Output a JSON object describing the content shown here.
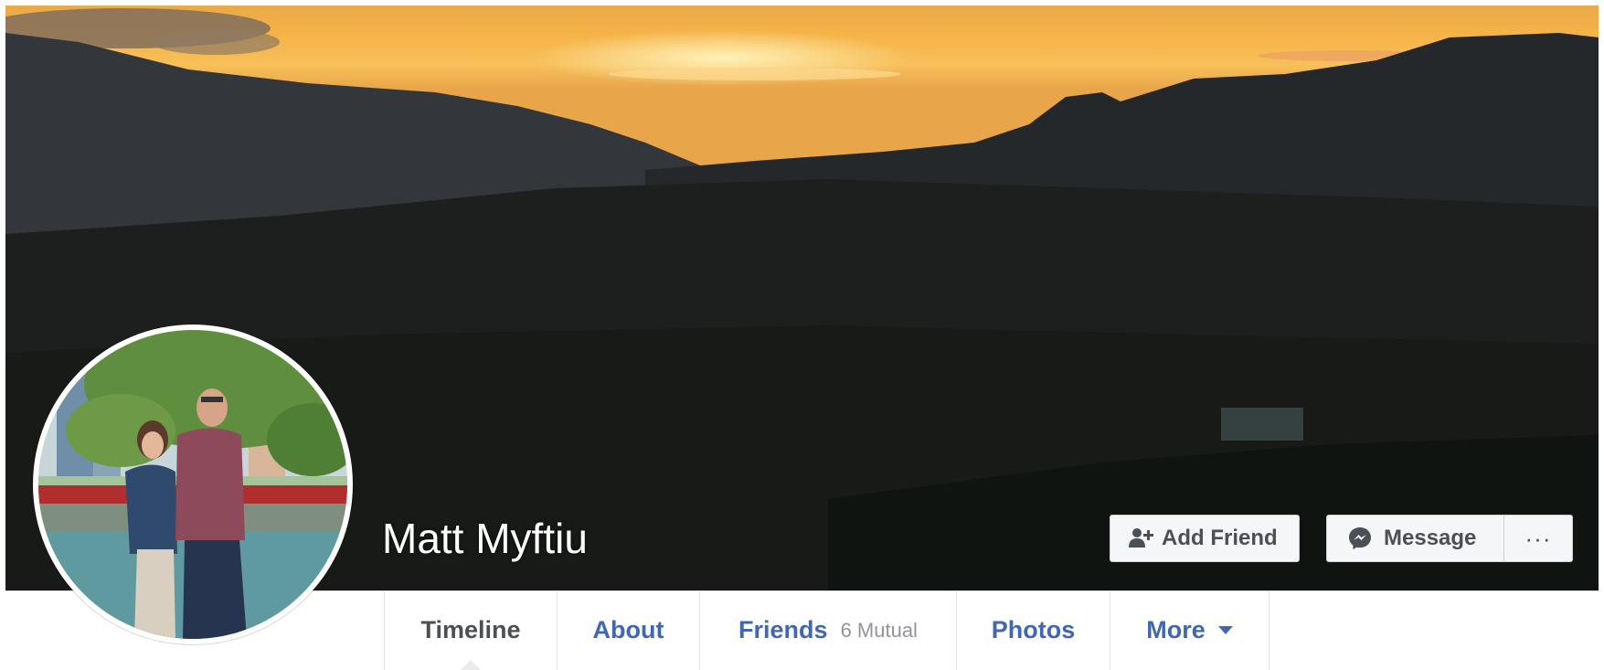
{
  "profile": {
    "name": "Matt Myftiu"
  },
  "actions": {
    "add_friend_label": "Add Friend",
    "message_label": "Message",
    "more_label": "···"
  },
  "tabs": [
    {
      "label": "Timeline",
      "active": true
    },
    {
      "label": "About"
    },
    {
      "label": "Friends",
      "extra": "6 Mutual"
    },
    {
      "label": "Photos"
    },
    {
      "label": "More"
    }
  ],
  "icons": {
    "add_friend": "add-person-icon",
    "message": "messenger-icon",
    "more": "ellipsis-icon",
    "more_dropdown": "caret-down-icon"
  },
  "colors": {
    "link_blue": "#4267b2",
    "active_tab_text": "#4b4f56",
    "button_bg": "#f5f6f7"
  }
}
